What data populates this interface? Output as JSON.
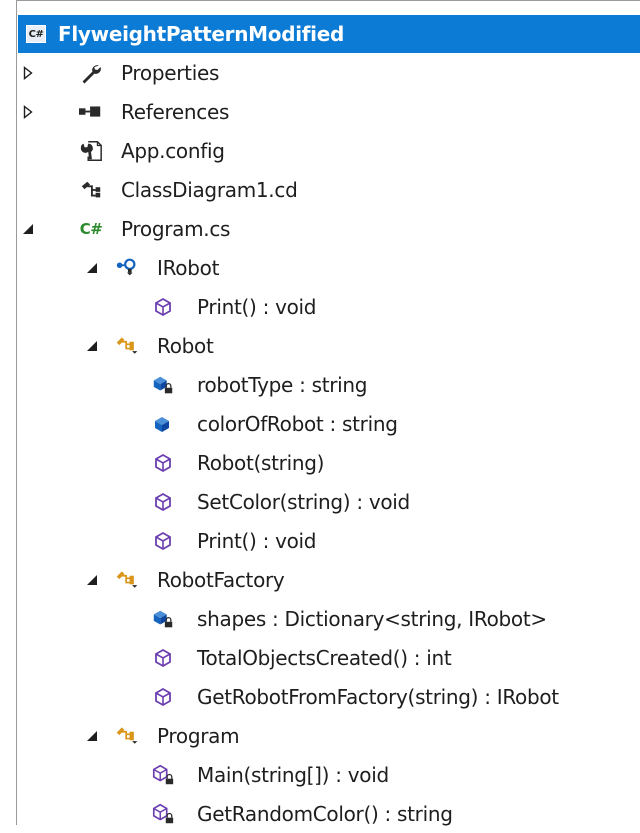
{
  "tree": {
    "project": {
      "label": "FlyweightPatternModified",
      "icon": "csharp-project-icon"
    },
    "items": [
      {
        "label": "Properties",
        "icon": "wrench-icon",
        "expander": "collapsed"
      },
      {
        "label": "References",
        "icon": "references-icon",
        "expander": "collapsed"
      },
      {
        "label": "App.config",
        "icon": "config-file-icon",
        "expander": "none"
      },
      {
        "label": "ClassDiagram1.cd",
        "icon": "class-diagram-icon",
        "expander": "none"
      },
      {
        "label": "Program.cs",
        "icon": "csharp-file-icon",
        "expander": "expanded"
      },
      {
        "label": "IRobot",
        "icon": "interface-icon",
        "expander": "expanded"
      },
      {
        "label": "Print() : void",
        "icon": "method-icon",
        "expander": "none"
      },
      {
        "label": "Robot",
        "icon": "class-icon",
        "expander": "expanded"
      },
      {
        "label": "robotType : string",
        "icon": "private-field-icon",
        "expander": "none"
      },
      {
        "label": "colorOfRobot : string",
        "icon": "field-icon",
        "expander": "none"
      },
      {
        "label": "Robot(string)",
        "icon": "method-icon",
        "expander": "none"
      },
      {
        "label": "SetColor(string) : void",
        "icon": "method-icon",
        "expander": "none"
      },
      {
        "label": "Print() : void",
        "icon": "method-icon",
        "expander": "none"
      },
      {
        "label": "RobotFactory",
        "icon": "class-icon",
        "expander": "expanded"
      },
      {
        "label": "shapes : Dictionary<string, IRobot>",
        "icon": "private-field-icon",
        "expander": "none"
      },
      {
        "label": "TotalObjectsCreated() : int",
        "icon": "method-icon",
        "expander": "none"
      },
      {
        "label": "GetRobotFromFactory(string) : IRobot",
        "icon": "method-icon",
        "expander": "none"
      },
      {
        "label": "Program",
        "icon": "class-icon",
        "expander": "expanded"
      },
      {
        "label": "Main(string[]) : void",
        "icon": "private-method-icon",
        "expander": "none"
      },
      {
        "label": "GetRandomColor() : string",
        "icon": "private-method-icon",
        "expander": "none"
      }
    ]
  },
  "colors": {
    "selection": "#0b7bd6",
    "method_purple": "#6c3fb0",
    "field_blue": "#1565c0",
    "class_orange": "#d9961a",
    "csharp_green": "#2b8a2b"
  }
}
